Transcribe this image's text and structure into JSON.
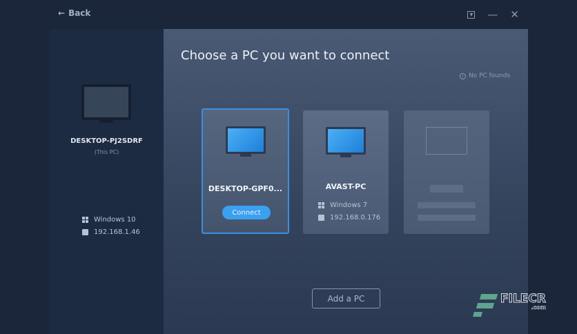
{
  "header": {
    "back_label": "Back"
  },
  "this_pc": {
    "name": "DESKTOP-PJ2SDRF",
    "subtitle": "(This PC)",
    "os": "Windows 10",
    "ip": "192.168.1.46"
  },
  "main": {
    "title": "Choose a PC you want to connect",
    "status": "No PC founds",
    "add_pc_label": "Add a PC"
  },
  "pcs": [
    {
      "name": "DESKTOP-GPF0...",
      "action": "Connect"
    },
    {
      "name": "AVAST-PC",
      "os": "Windows 7",
      "ip": "192.168.0.176"
    }
  ],
  "watermark": {
    "text": "FILECR",
    ".com": ".com"
  },
  "colors": {
    "accent": "#3aa0f0",
    "background": "#1b263a"
  }
}
